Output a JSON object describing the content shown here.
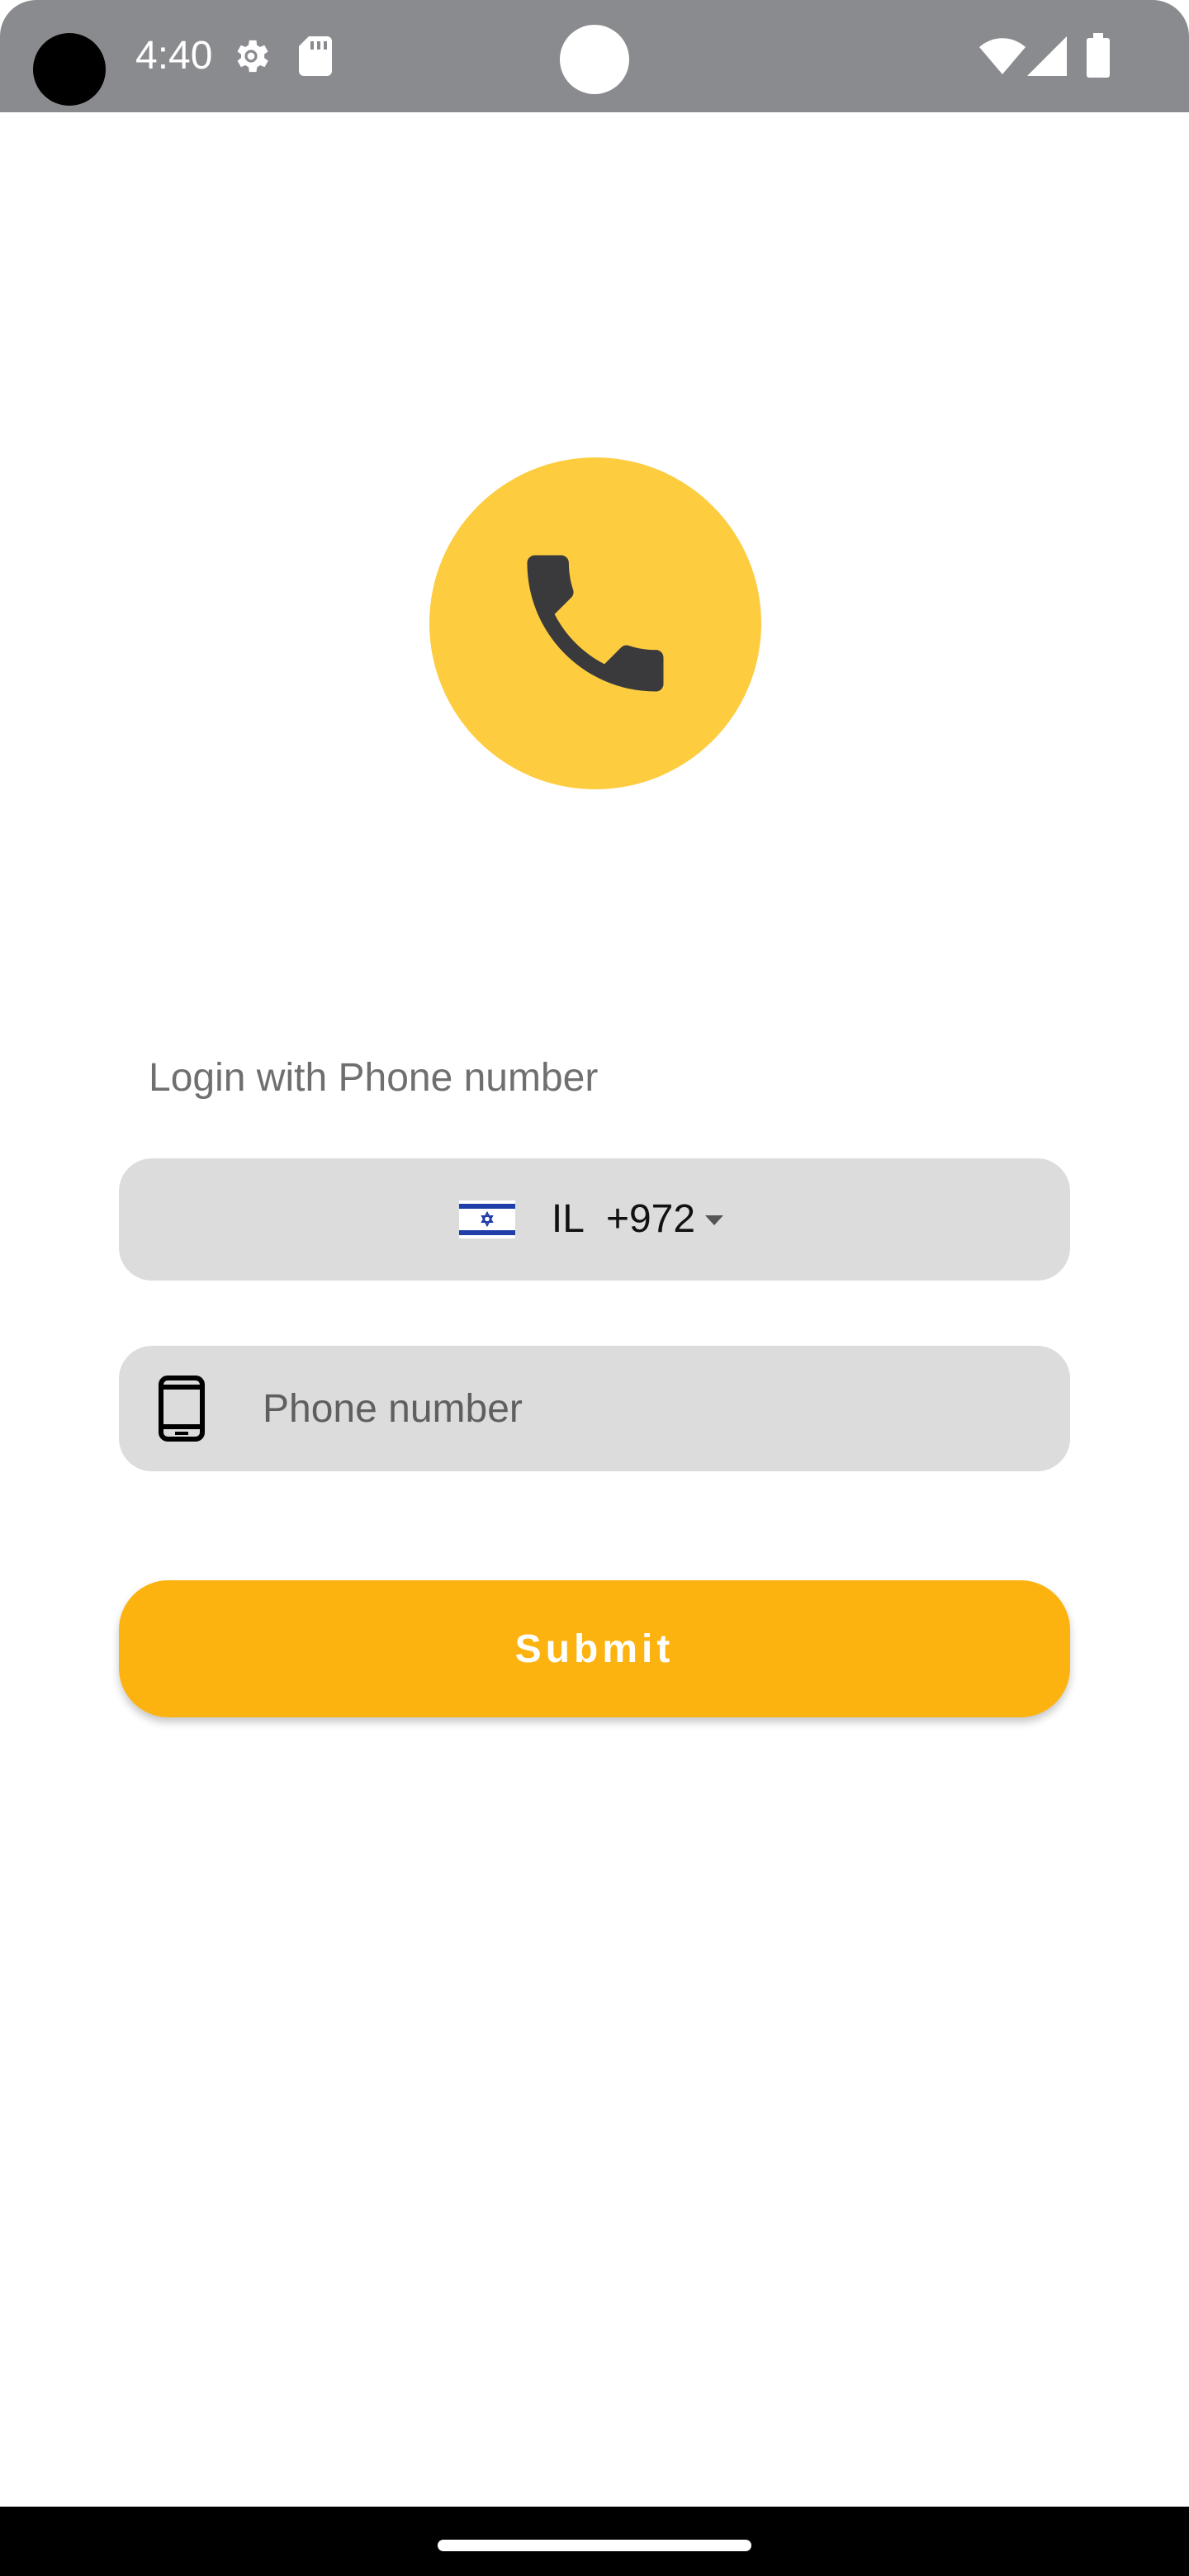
{
  "status_bar": {
    "time": "4:40",
    "icons": [
      "settings-gear-icon",
      "sd-card-icon",
      "wifi-icon",
      "signal-icon",
      "battery-icon"
    ]
  },
  "logo": {
    "icon": "phone-handset-icon",
    "background_color": "#fdcc3f",
    "icon_color": "#3a3a3c"
  },
  "login": {
    "heading": "Login with Phone number",
    "country": {
      "flag_icon": "israel-flag-icon",
      "code": "IL",
      "dial_code": "+972"
    },
    "phone": {
      "icon": "smartphone-icon",
      "value": "",
      "placeholder": "Phone number"
    },
    "submit_label": "Submit"
  },
  "colors": {
    "accent": "#fdb30f",
    "field_background": "#dcdcdd",
    "status_bar": "#8a8b8f"
  }
}
